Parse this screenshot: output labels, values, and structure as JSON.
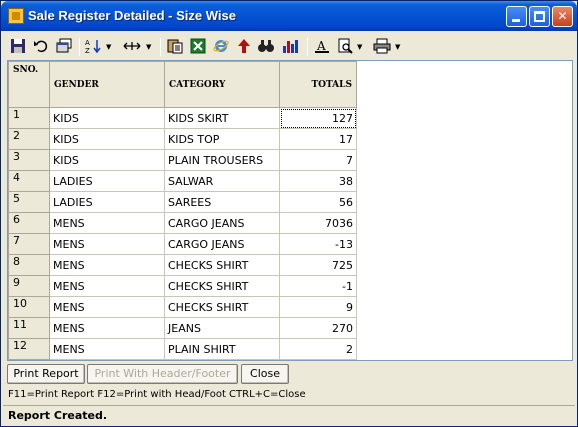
{
  "window": {
    "title": "Sale Register Detailed - Size Wise"
  },
  "toolbar": {
    "icons": [
      "save-icon",
      "undo-icon",
      "copy-window-icon",
      "sort-az-icon",
      "column-width-icon",
      "paste-icon",
      "excel-icon",
      "ie-icon",
      "up-arrow-icon",
      "find-icon",
      "chart-icon",
      "font-icon",
      "print-preview-icon",
      "printer-icon"
    ]
  },
  "table": {
    "headers": {
      "sno": "SNO.",
      "gender": "GENDER",
      "category": "CATEGORY",
      "totals": "TOTALS"
    },
    "rows": [
      {
        "sno": "1",
        "gender": "KIDS",
        "category": "KIDS SKIRT",
        "totals": "127"
      },
      {
        "sno": "2",
        "gender": "KIDS",
        "category": "KIDS TOP",
        "totals": "17"
      },
      {
        "sno": "3",
        "gender": "KIDS",
        "category": "PLAIN TROUSERS",
        "totals": "7"
      },
      {
        "sno": "4",
        "gender": "LADIES",
        "category": "SALWAR",
        "totals": "38"
      },
      {
        "sno": "5",
        "gender": "LADIES",
        "category": "SAREES",
        "totals": "56"
      },
      {
        "sno": "6",
        "gender": "MENS",
        "category": "CARGO JEANS",
        "totals": "7036"
      },
      {
        "sno": "7",
        "gender": "MENS",
        "category": "CARGO JEANS",
        "totals": "-13"
      },
      {
        "sno": "8",
        "gender": "MENS",
        "category": "CHECKS SHIRT",
        "totals": "725"
      },
      {
        "sno": "9",
        "gender": "MENS",
        "category": "CHECKS SHIRT",
        "totals": "-1"
      },
      {
        "sno": "10",
        "gender": "MENS",
        "category": "CHECKS SHIRT",
        "totals": "9"
      },
      {
        "sno": "11",
        "gender": "MENS",
        "category": "JEANS",
        "totals": "270"
      },
      {
        "sno": "12",
        "gender": "MENS",
        "category": "PLAIN SHIRT",
        "totals": "2"
      }
    ]
  },
  "buttons": {
    "print_report": "Print Report",
    "print_head_foot": "Print With Header/Footer",
    "close": "Close"
  },
  "hint": "F11=Print Report  F12=Print with Head/Foot  CTRL+C=Close",
  "status": "Report Created."
}
